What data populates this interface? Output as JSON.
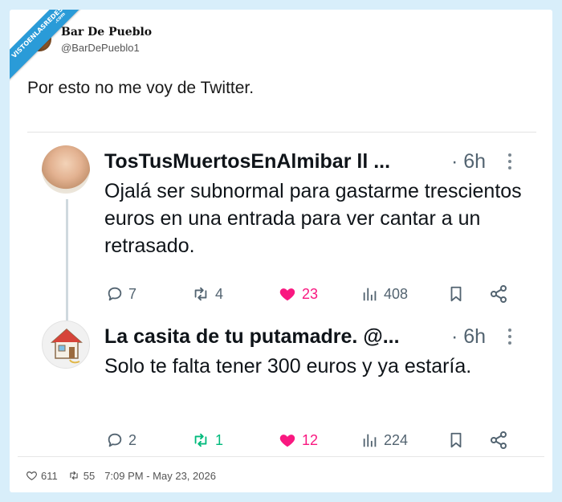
{
  "watermark": {
    "line1": "VISTOENLASREDES",
    "line2": ".com"
  },
  "tweet": {
    "author_name": "Bar De Pueblo",
    "author_handle": "@BarDePueblo1",
    "text": "Por esto no me voy de Twitter.",
    "likes": "611",
    "retweets": "55",
    "timestamp": "7:09 PM - May 23, 2026"
  },
  "replies": [
    {
      "name": "TosTusMuertosEnAlmibar ll ...",
      "time": "· 6h",
      "text": "Ojalá ser subnormal para gastarme trescientos euros en una entrada para ver cantar a un retrasado.",
      "replies": "7",
      "retweets": "4",
      "likes": "23",
      "views": "408",
      "retweet_color": "#536471"
    },
    {
      "name": "La casita de tu putamadre. @...",
      "time": "· 6h",
      "text": "Solo te falta tener 300 euros y ya estaría.",
      "replies": "2",
      "retweets": "1",
      "likes": "12",
      "views": "224",
      "retweet_color": "#00ba7c"
    }
  ],
  "colors": {
    "like": "#f91880",
    "retweet_active": "#00ba7c",
    "muted": "#536471",
    "ribbon": "#2a9bd8",
    "background": "#d8eefa"
  }
}
